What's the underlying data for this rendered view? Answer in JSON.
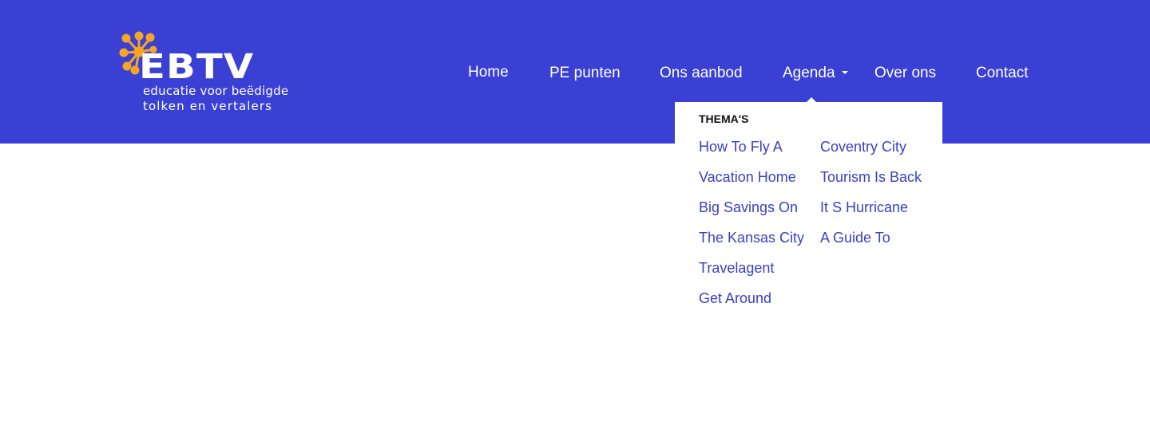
{
  "colors": {
    "header_bg": "#3b40d4",
    "logo_dots": "#f5a623",
    "link": "#3a3fc4",
    "white": "#ffffff"
  },
  "logo": {
    "wordmark": "EBTV",
    "tagline_line1": "educatie voor beëdigde",
    "tagline_line2": "tolken en vertalers"
  },
  "nav": {
    "items": [
      {
        "label": "Home"
      },
      {
        "label": "PE punten"
      },
      {
        "label": "Ons aanbod"
      },
      {
        "label": "Agenda",
        "has_dropdown": true
      },
      {
        "label": "Over ons"
      },
      {
        "label": "Contact"
      }
    ]
  },
  "dropdown": {
    "heading": "THEMA'S",
    "column1": [
      "How To Fly A",
      "Vacation Home",
      "Big Savings On",
      "The Kansas City",
      "Travelagent",
      "Get Around"
    ],
    "column2": [
      "Coventry City",
      "Tourism Is Back",
      "It S Hurricane",
      "A Guide To"
    ]
  }
}
